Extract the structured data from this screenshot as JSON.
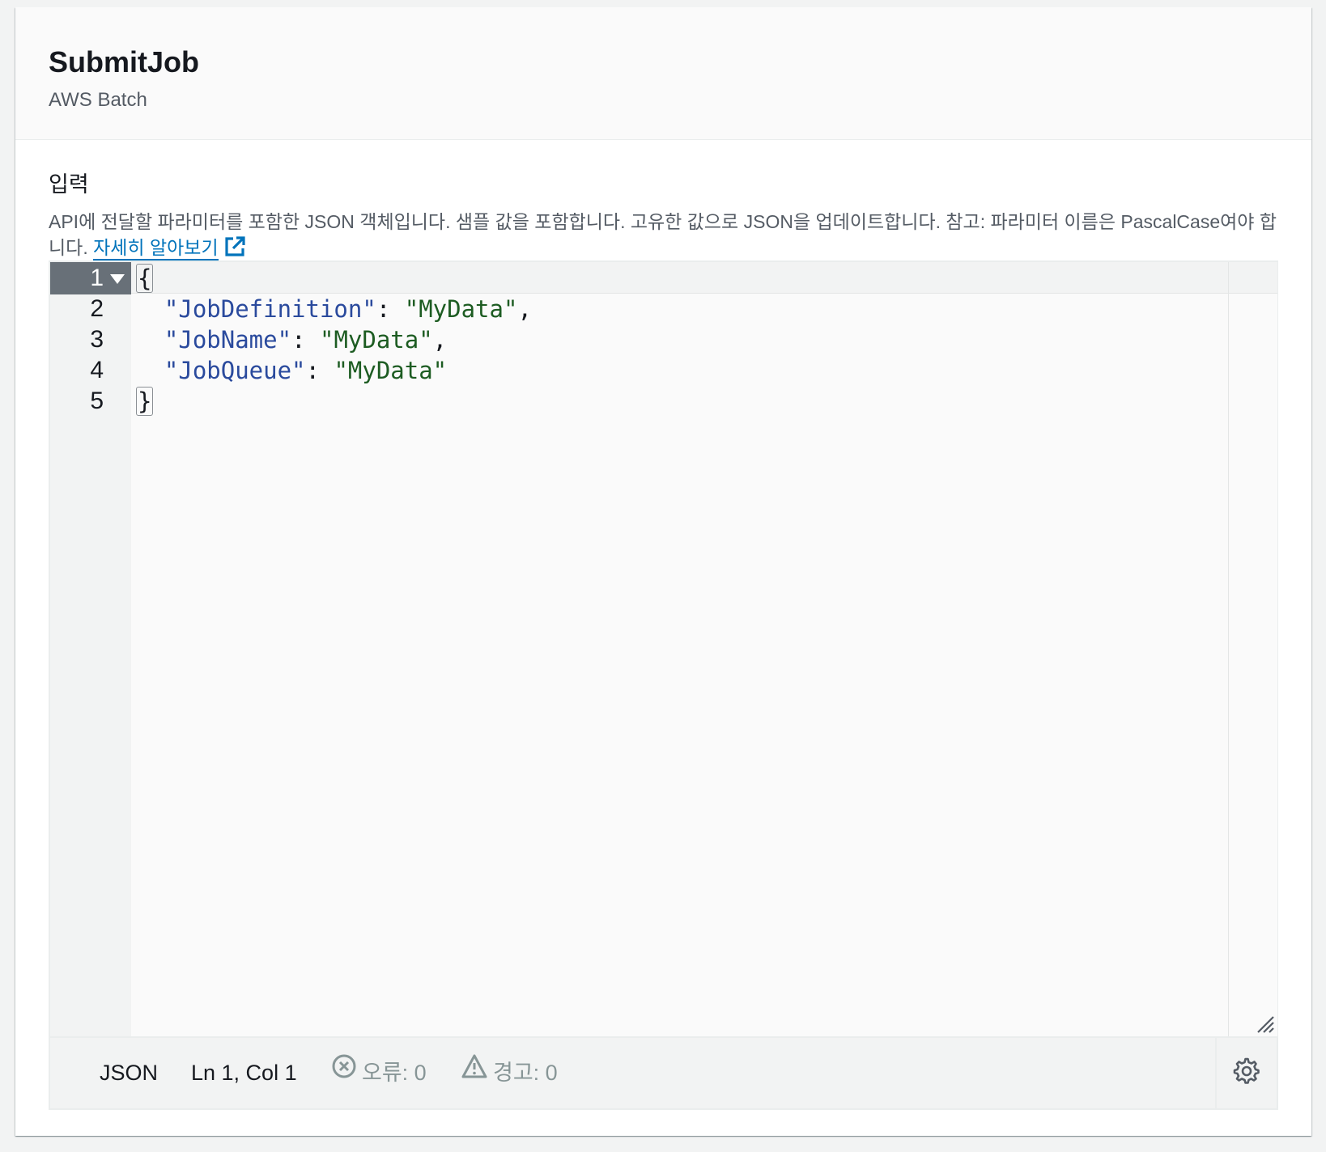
{
  "header": {
    "title": "SubmitJob",
    "subtitle": "AWS Batch"
  },
  "input_field": {
    "label": "입력",
    "description": "API에 전달할 파라미터를 포함한 JSON 객체입니다. 샘플 값을 포함합니다. 고유한 값으로 JSON을 업데이트합니다. 참고: 파라미터 이름은 PascalCase여야 합니다. ",
    "learn_more": "자세히 알아보기",
    "learn_more_icon": "external-link-icon"
  },
  "editor": {
    "line_numbers": [
      "1",
      "2",
      "3",
      "4",
      "5"
    ],
    "active_line": 1,
    "lines": [
      {
        "open_brace": "{"
      },
      {
        "indent": "  ",
        "key": "\"JobDefinition\"",
        "colon": ": ",
        "value": "\"MyData\"",
        "comma": ","
      },
      {
        "indent": "  ",
        "key": "\"JobName\"",
        "colon": ": ",
        "value": "\"MyData\"",
        "comma": ","
      },
      {
        "indent": "  ",
        "key": "\"JobQueue\"",
        "colon": ": ",
        "value": "\"MyData\"",
        "comma": ""
      },
      {
        "close_brace": "}"
      }
    ],
    "colors": {
      "key": "#2a4a9d",
      "string": "#1d5c22"
    }
  },
  "status_bar": {
    "language": "JSON",
    "cursor": "Ln 1, Col 1",
    "errors_label": "오류: 0",
    "warnings_label": "경고: 0",
    "errors_icon": "error-circle-icon",
    "warnings_icon": "warning-triangle-icon",
    "settings_icon": "gear-icon"
  },
  "colors": {
    "accent_link": "#0073bb",
    "active_gutter": "#687078",
    "muted_text": "#879596"
  }
}
